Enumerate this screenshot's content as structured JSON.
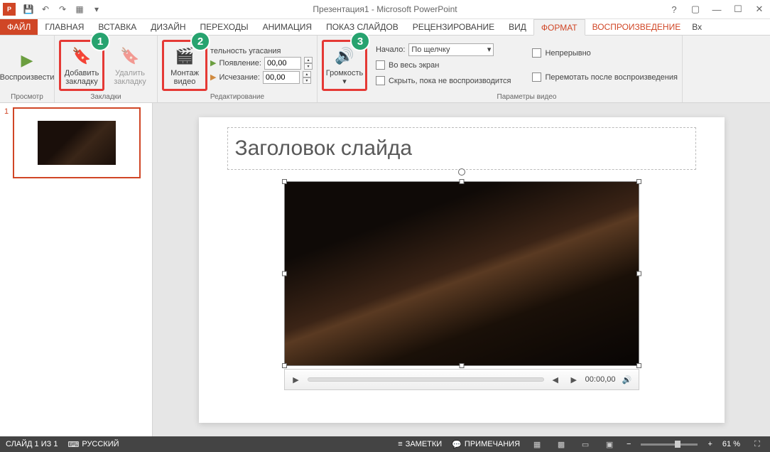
{
  "titlebar": {
    "title": "Презентация1 - Microsoft PowerPoint"
  },
  "tabs": {
    "file": "ФАЙЛ",
    "items": [
      "ГЛАВНАЯ",
      "ВСТАВКА",
      "ДИЗАЙН",
      "ПЕРЕХОДЫ",
      "АНИМАЦИЯ",
      "ПОКАЗ СЛАЙДОВ",
      "РЕЦЕНЗИРОВАНИЕ",
      "ВИД",
      "ФОРМАТ",
      "ВОСПРОИЗВЕДЕНИЕ"
    ],
    "active": "ВОСПРОИЗВЕДЕНИЕ",
    "format_active": true,
    "overflow": "Вх"
  },
  "ribbon": {
    "groups": {
      "preview": {
        "label": "Просмотр",
        "play": "Воспроизвести"
      },
      "bookmarks": {
        "label": "Закладки",
        "add_top": "Добавить",
        "add_bottom": "закладку",
        "remove_top": "Удалить",
        "remove_bottom": "закладку"
      },
      "editing": {
        "label": "Редактирование",
        "trim_top": "Монтаж",
        "trim_bottom": "видео",
        "duration_label": "тельность угасания",
        "appear": "Появление:",
        "appear_val": "00,00",
        "disappear": "Исчезание:",
        "disappear_val": "00,00"
      },
      "volume": {
        "label": "Громкость"
      },
      "video_opts": {
        "label": "Параметры видео",
        "start": "Начало:",
        "start_val": "По щелчку",
        "fullscreen": "Во весь экран",
        "hide": "Скрыть, пока не воспроизводится",
        "loop": "Непрерывно",
        "rewind": "Перемотать после воспроизведения"
      }
    },
    "callouts": {
      "1": "1",
      "2": "2",
      "3": "3"
    }
  },
  "slide": {
    "title": "Заголовок слайда",
    "time": "00:00,00"
  },
  "thumbs": {
    "num": "1"
  },
  "statusbar": {
    "slide_of": "СЛАЙД 1 ИЗ 1",
    "lang": "РУССКИЙ",
    "notes": "ЗАМЕТКИ",
    "comments": "ПРИМЕЧАНИЯ",
    "zoom": "61 %",
    "minus": "−",
    "plus": "+"
  }
}
